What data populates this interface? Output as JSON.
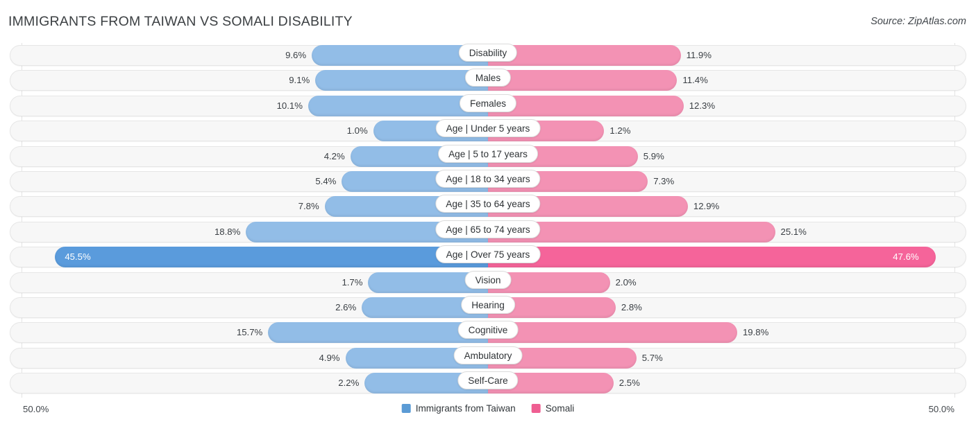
{
  "header": {
    "title": "IMMIGRANTS FROM TAIWAN VS SOMALI DISABILITY",
    "source": "Source: ZipAtlas.com"
  },
  "axis": {
    "left_label": "50.0%",
    "right_label": "50.0%"
  },
  "legend": {
    "items": [
      {
        "label": "Immigrants from Taiwan",
        "color": "#5b9bd5"
      },
      {
        "label": "Somali",
        "color": "#ef5e92"
      }
    ]
  },
  "colors": {
    "left_bar": "#92bde7",
    "right_bar": "#f392b4",
    "left_bar_highlight": "#5a9bdc",
    "right_bar_highlight": "#f5649a",
    "track": "#f7f7f7",
    "track_border": "#e6e6e6",
    "gridline": "#e3e3e3",
    "text": "#3a3f44"
  },
  "chart_data": {
    "type": "bar",
    "subtype": "diverging-bidirectional",
    "title": "IMMIGRANTS FROM TAIWAN VS SOMALI DISABILITY",
    "xlabel": "",
    "ylabel": "",
    "xlim": [
      -50.0,
      50.0
    ],
    "axis_left_max": 50.0,
    "axis_right_max": 50.0,
    "grid": false,
    "legend_position": "bottom-center",
    "categories": [
      "Disability",
      "Males",
      "Females",
      "Age | Under 5 years",
      "Age | 5 to 17 years",
      "Age | 18 to 34 years",
      "Age | 35 to 64 years",
      "Age | 65 to 74 years",
      "Age | Over 75 years",
      "Vision",
      "Hearing",
      "Cognitive",
      "Ambulatory",
      "Self-Care"
    ],
    "series": [
      {
        "name": "Immigrants from Taiwan",
        "color": "#92bde7",
        "values": [
          9.6,
          9.1,
          10.1,
          1.0,
          4.2,
          5.4,
          7.8,
          18.8,
          45.5,
          1.7,
          2.6,
          15.7,
          4.9,
          2.2
        ],
        "labels": [
          "9.6%",
          "9.1%",
          "10.1%",
          "1.0%",
          "4.2%",
          "5.4%",
          "7.8%",
          "18.8%",
          "45.5%",
          "1.7%",
          "2.6%",
          "15.7%",
          "4.9%",
          "2.2%"
        ]
      },
      {
        "name": "Somali",
        "color": "#f392b4",
        "values": [
          11.9,
          11.4,
          12.3,
          1.2,
          5.9,
          7.3,
          12.9,
          25.1,
          47.6,
          2.0,
          2.8,
          19.8,
          5.7,
          2.5
        ],
        "labels": [
          "11.9%",
          "11.4%",
          "12.3%",
          "1.2%",
          "5.9%",
          "7.3%",
          "12.9%",
          "25.1%",
          "47.6%",
          "2.0%",
          "2.8%",
          "19.8%",
          "5.7%",
          "2.5%"
        ]
      }
    ],
    "highlighted_rows": [
      8
    ]
  }
}
